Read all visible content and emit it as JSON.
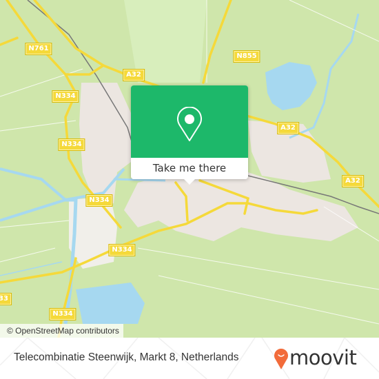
{
  "map": {
    "road_labels": [
      {
        "id": "n761",
        "text": "N761"
      },
      {
        "id": "a32-west",
        "text": "A32"
      },
      {
        "id": "n855",
        "text": "N855"
      },
      {
        "id": "n334-a",
        "text": "N334"
      },
      {
        "id": "n334-b",
        "text": "N334"
      },
      {
        "id": "a32-mid",
        "text": "A32"
      },
      {
        "id": "a32-east",
        "text": "A32"
      },
      {
        "id": "n334-c",
        "text": "N334"
      },
      {
        "id": "n334-d",
        "text": "N334"
      },
      {
        "id": "n333-partial",
        "text": "33"
      },
      {
        "id": "n334-e",
        "text": "N334"
      }
    ],
    "attribution": "© OpenStreetMap contributors",
    "colors": {
      "land": "#cfe6ab",
      "urban": "#ece6e1",
      "water": "#a6d8f0",
      "road_major": "#f5d93a"
    }
  },
  "popup": {
    "icon": "map-pin-icon",
    "button_label": "Take me there",
    "color": "#1db86a"
  },
  "footer": {
    "address": "Telecombinatie Steenwijk, Markt 8, Netherlands",
    "brand": "moovit",
    "brand_icon": "moovit-pin-smile-icon",
    "brand_color": "#f26b3a"
  }
}
